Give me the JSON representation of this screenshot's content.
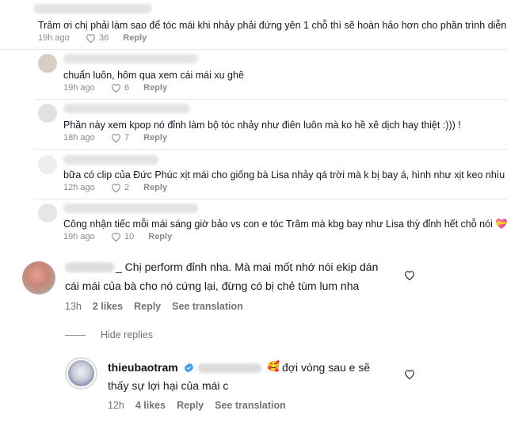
{
  "tiktok": {
    "top_comment": {
      "text": "Trâm ơi chị phải làm sao để tóc mái khi nhảy phải đứng yên 1 chỗ thì sẽ hoàn hảo hơn cho phần trình diễn",
      "time": "19h ago",
      "likes": "36",
      "reply_label": "Reply"
    },
    "replies": [
      {
        "text": "chuẩn luôn, hôm qua xem cái mái xu ghê",
        "time": "19h ago",
        "likes": "6",
        "reply_label": "Reply"
      },
      {
        "text": "Phần này xem kpop nó đỉnh làm bộ tóc nhảy như điên luôn mà ko hề xê dịch hay thiệt :))) !",
        "time": "18h ago",
        "likes": "7",
        "reply_label": "Reply"
      },
      {
        "text": "bữa có clip của Đức Phúc xịt mái cho giống bà Lisa nhảy qá trời mà k bị bay á, hình như xịt keo nhìu lắm",
        "time": "12h ago",
        "likes": "2",
        "reply_label": "Reply"
      },
      {
        "text": "Công nhận tiếc mỗi mái sáng giờ bảo vs con e tóc Trâm mà kbg bay như Lisa thỳ đỉnh hết chỗ nói 💝",
        "time": "19h ago",
        "likes": "10",
        "reply_label": "Reply"
      }
    ]
  },
  "instagram": {
    "comment": {
      "line1": "_ Chị perform đỉnh nha. Mà mai mốt nhớ nói ekip dán",
      "line2": "cái mái của bà cho nó cứng lại, đừng có bị chẻ tùm lum nha",
      "time": "13h",
      "likes": "2 likes",
      "reply_label": "Reply",
      "translate_label": "See translation"
    },
    "hide_replies_label": "Hide replies",
    "reply": {
      "username": "thieubaotram",
      "emoji": "🥰",
      "line1": "đợi vòng sau e sẽ",
      "line2": "thấy sự lợi hại của mái c",
      "time": "12h",
      "likes": "4 likes",
      "reply_label": "Reply",
      "translate_label": "See translation"
    }
  },
  "colors": {
    "verified": "#3797f0",
    "meta_gray": "#737373"
  }
}
